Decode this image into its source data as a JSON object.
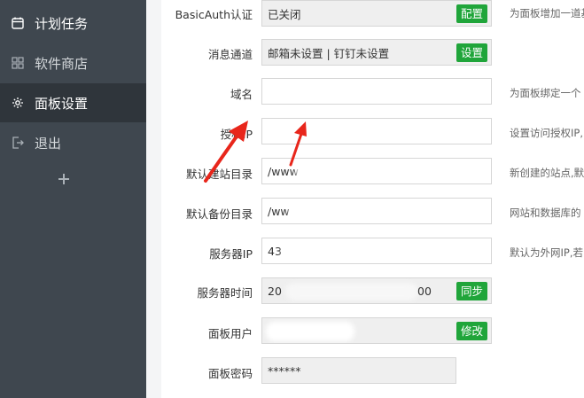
{
  "sidebar": {
    "items": [
      {
        "label": "计划任务",
        "icon": "calendar-icon"
      },
      {
        "label": "软件商店",
        "icon": "grid-icon"
      },
      {
        "label": "面板设置",
        "icon": "gear-icon",
        "active": true
      },
      {
        "label": "退出",
        "icon": "logout-icon"
      }
    ],
    "add_icon": "plus-icon"
  },
  "form": {
    "basic_auth": {
      "label": "BasicAuth认证",
      "value": "已关闭",
      "button": "配置",
      "hint": "为面板增加一道基"
    },
    "message_channel": {
      "label": "消息通道",
      "value": "邮箱未设置 | 钉钉未设置",
      "button": "设置"
    },
    "domain": {
      "label": "域名",
      "value": "",
      "hint": "为面板绑定一个"
    },
    "auth_ip": {
      "label": "授权IP",
      "value": "",
      "hint": "设置访问授权IP,"
    },
    "default_site_dir": {
      "label": "默认建站目录",
      "value": "/www",
      "hint": "新创建的站点,默"
    },
    "default_backup_dir": {
      "label": "默认备份目录",
      "value": "/ww",
      "hint": "网站和数据库的"
    },
    "server_ip": {
      "label": "服务器IP",
      "value": "43",
      "hint": "默认为外网IP,若"
    },
    "server_time": {
      "label": "服务器时间",
      "value_start": "20",
      "value_end": "00",
      "button": "同步"
    },
    "panel_user": {
      "label": "面板用户",
      "value": "",
      "button": "修改"
    },
    "panel_password": {
      "label": "面板密码",
      "value": "******"
    }
  },
  "colors": {
    "sidebar_bg": "#3f474f",
    "sidebar_active": "#2f353b",
    "accent_green": "#20a53a",
    "annotation_red": "#e8261b"
  }
}
